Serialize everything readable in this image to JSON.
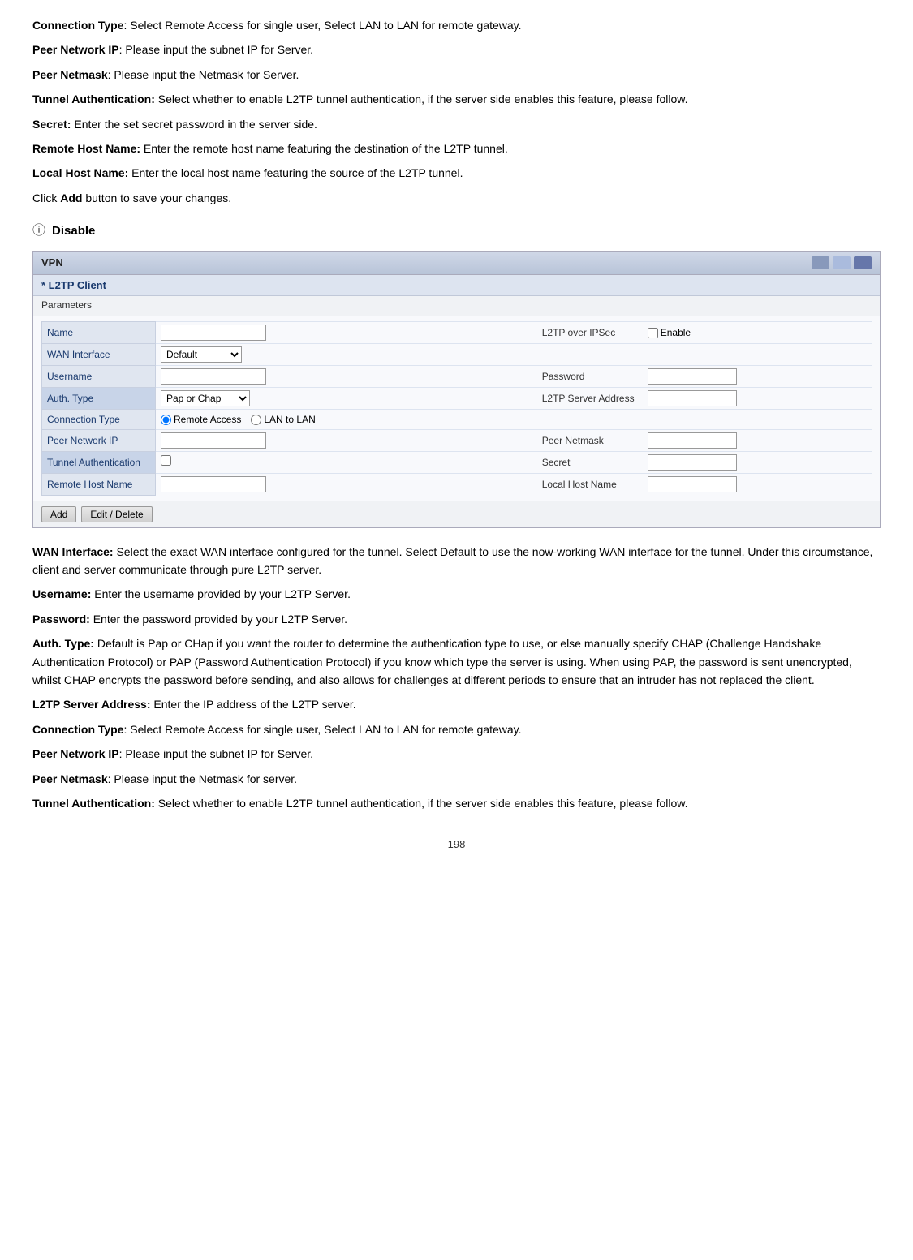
{
  "paragraphs_top": [
    {
      "label": "Connection Type",
      "bold": true,
      "colon": true,
      "text": " Select Remote Access for single user, Select LAN to LAN for remote gateway."
    },
    {
      "label": "Peer Network IP",
      "bold": true,
      "colon": true,
      "text": " Please input the subnet IP for Server."
    },
    {
      "label": "Peer Netmask",
      "bold": true,
      "colon": true,
      "text": " Please input the Netmask for Server."
    },
    {
      "label": "Tunnel  Authentication",
      "bold": true,
      "colon": true,
      "text": "  Select whether to enable L2TP tunnel authentication, if the server side enables this feature, please follow."
    },
    {
      "label": "Secret",
      "bold": true,
      "colon": true,
      "text": " Enter the set secret password in the server side."
    },
    {
      "label": "Remote Host Name",
      "bold": true,
      "colon": true,
      "text": " Enter the remote host name featuring the destination of the L2TP tunnel."
    },
    {
      "label": "Local Host Name",
      "bold": true,
      "colon": true,
      "text": " Enter the local host name featuring the source of the L2TP tunnel."
    },
    {
      "plain": "Click "
    },
    {
      "label": "Add",
      "bold": true,
      "text": " button to save your changes."
    }
  ],
  "info_icon": "ⓘ",
  "info_label": "Disable",
  "vpn": {
    "header": "VPN",
    "section_title": "* L2TP Client",
    "sub_label": "Parameters",
    "fields_left": [
      {
        "label": "Name",
        "highlight": false
      },
      {
        "label": "WAN Interface",
        "highlight": false
      },
      {
        "label": "Username",
        "highlight": false
      },
      {
        "label": "Auth. Type",
        "highlight": true
      },
      {
        "label": "Connection Type",
        "highlight": false
      },
      {
        "label": "Peer Network IP",
        "highlight": false
      },
      {
        "label": "Tunnel Authentication",
        "highlight": true
      },
      {
        "label": "Remote Host Name",
        "highlight": false
      }
    ],
    "wan_interface_value": "Default",
    "auth_type_value": "Pap or Chap",
    "connection_type_options": [
      {
        "label": "Remote Access",
        "selected": true
      },
      {
        "label": "LAN to LAN",
        "selected": false
      }
    ],
    "fields_right": [
      {
        "label": "L2TP over IPSec",
        "value": "Enable",
        "checkbox": true
      },
      {
        "label": "",
        "value": ""
      },
      {
        "label": "Password",
        "value": ""
      },
      {
        "label": "L2TP Server Address",
        "value": ""
      },
      {
        "label": "",
        "value": ""
      },
      {
        "label": "Peer Netmask",
        "value": ""
      },
      {
        "label": "Secret",
        "value": ""
      },
      {
        "label": "Local Host Name",
        "value": ""
      }
    ],
    "buttons": [
      {
        "label": "Add"
      },
      {
        "label": "Edit / Delete"
      }
    ]
  },
  "paragraphs_bottom": [
    {
      "label": "WAN Interface",
      "bold": true,
      "colon": true,
      "text": " Select the exact WAN interface configured for the tunnel. Select Default to use the now-working WAN interface for the tunnel. Under this circumstance, client and server communicate through pure L2TP server."
    },
    {
      "label": "Username",
      "bold": true,
      "colon": true,
      "text": " Enter the username provided by your L2TP Server."
    },
    {
      "label": "Password",
      "bold": true,
      "colon": true,
      "text": " Enter the password provided by your L2TP Server."
    },
    {
      "label": "Auth.  Type",
      "bold": true,
      "colon": true,
      "text": "  Default is Pap or CHap if you want the router to determine the authentication type to use, or else manually specify CHAP (Challenge Handshake Authentication Protocol) or PAP (Password Authentication Protocol) if you know which type the server is using. When using PAP, the password is sent unencrypted, whilst CHAP encrypts the password before sending, and also allows for challenges at different periods to ensure that an intruder has not replaced the client."
    },
    {
      "label": "L2TP Server Address",
      "bold": true,
      "colon": true,
      "text": " Enter the IP address of the L2TP server."
    },
    {
      "label": "Connection Type",
      "bold": true,
      "colon": true,
      "text": " Select Remote Access for single user, Select LAN to LAN for remote gateway."
    },
    {
      "label": "Peer Network IP",
      "bold": true,
      "colon": true,
      "text": " Please input the subnet IP for Server."
    },
    {
      "label": "Peer Netmask",
      "bold": true,
      "colon": true,
      "text": " Please input the Netmask for server."
    },
    {
      "label": "Tunnel  Authentication",
      "bold": true,
      "colon": true,
      "text": "  Select whether to enable L2TP tunnel authentication, if the server side enables this feature, please follow."
    }
  ],
  "page_number": "198"
}
